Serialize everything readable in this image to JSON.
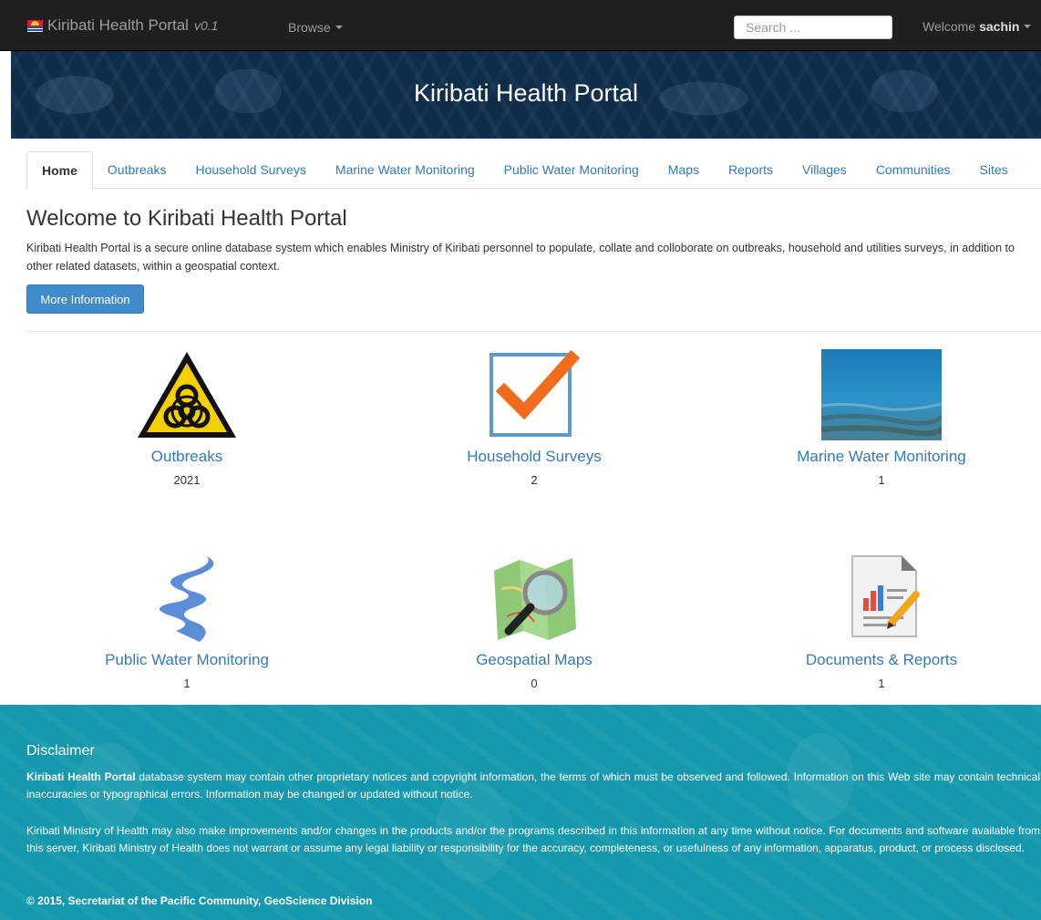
{
  "navbar": {
    "brand": "Kiribati Health Portal",
    "version": "v0.1",
    "browse_label": "Browse",
    "search_placeholder": "Search ...",
    "welcome_prefix": "Welcome",
    "user": "sachin"
  },
  "banner": {
    "title": "Kiribati Health Portal"
  },
  "tabs": [
    {
      "label": "Home",
      "active": true
    },
    {
      "label": "Outbreaks"
    },
    {
      "label": "Household Surveys"
    },
    {
      "label": "Marine Water Monitoring"
    },
    {
      "label": "Public Water Monitoring"
    },
    {
      "label": "Maps"
    },
    {
      "label": "Reports"
    },
    {
      "label": "Villages"
    },
    {
      "label": "Communities"
    },
    {
      "label": "Sites"
    }
  ],
  "main": {
    "title": "Welcome to Kiribati Health Portal",
    "intro": "Kiribati Health Portal is a secure online database system which enables Ministry of Kiribati personnel to populate, collate and colloborate on outbreaks, household and utilities surveys, in addition to other related datasets, within a geospatial context.",
    "more_button": "More Information"
  },
  "tiles": [
    {
      "label": "Outbreaks",
      "count": "2021",
      "icon": "biohazard-icon"
    },
    {
      "label": "Household Surveys",
      "count": "2",
      "icon": "checkbox-icon"
    },
    {
      "label": "Marine Water Monitoring",
      "count": "1",
      "icon": "sea-water-image"
    },
    {
      "label": "Public Water Monitoring",
      "count": "1",
      "icon": "water-stream-icon"
    },
    {
      "label": "Geospatial Maps",
      "count": "0",
      "icon": "map-magnifier-icon"
    },
    {
      "label": "Documents & Reports",
      "count": "1",
      "icon": "report-document-icon"
    }
  ],
  "footer": {
    "heading": "Disclaimer",
    "p1_strong": "Kiribati Health Portal",
    "p1_rest": " database system may contain other proprietary notices and copyright information, the terms of which must be observed and followed. Information on this Web site may contain technical inaccuracies or typographical errors. Information may be changed or updated without notice.",
    "p2": "Kiribati Ministry of Health may also make improvements and/or changes in the products and/or the programs described in this information at any time without notice. For documents and software available from this server, Kiribati Ministry of Health does not warrant or assume any legal liability or responsibility for the accuracy, completeness, or usefulness of any information, apparatus, product, or process disclosed.",
    "copyright": "© 2015, Secretariat of the Pacific Community, GeoScience Division"
  },
  "colors": {
    "navbar_bg": "#1f1f1f",
    "banner_bg": "#0f2c48",
    "link": "#337ab7",
    "button": "#428bca",
    "footer_bg": "#1598ad",
    "check_orange": "#f26c1e"
  }
}
